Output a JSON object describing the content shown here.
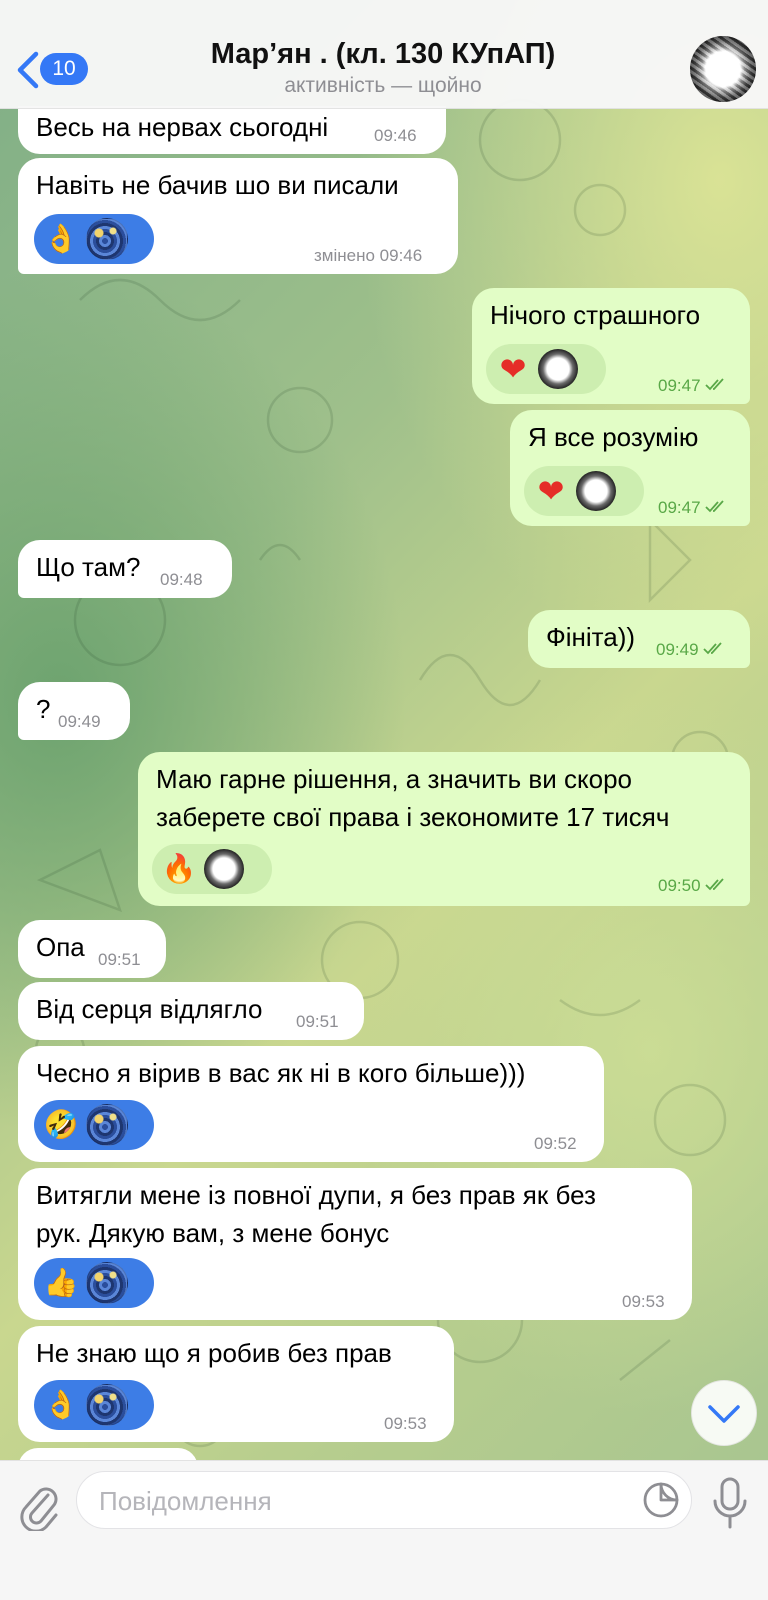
{
  "header": {
    "back_count": "10",
    "title": "Мар’ян . (кл. 130 КУпАП)",
    "status": "активність — щойно"
  },
  "messages": [
    {
      "side": "in",
      "text": "Весь на нервах сьогодні",
      "time": "09:46"
    },
    {
      "side": "in",
      "text": "Навіть не бачив шо ви писали",
      "time": "змінено 09:46",
      "reaction": "👌"
    },
    {
      "side": "out",
      "text": "Нічого страшного",
      "time": "09:47",
      "reaction": "❤"
    },
    {
      "side": "out",
      "text": "Я все розумію",
      "time": "09:47",
      "reaction": "❤"
    },
    {
      "side": "in",
      "text": "Що там?",
      "time": "09:48"
    },
    {
      "side": "out",
      "text": "Фініта))",
      "time": "09:49"
    },
    {
      "side": "in",
      "text": "?",
      "time": "09:49"
    },
    {
      "side": "out",
      "lines": [
        "Маю гарне рішення, а значить ви скоро",
        "заберете свої права і зекономите 17 тисяч"
      ],
      "time": "09:50",
      "reaction": "🔥"
    },
    {
      "side": "in",
      "text": "Опа",
      "time": "09:51"
    },
    {
      "side": "in",
      "text": "Від серця відлягло",
      "time": "09:51"
    },
    {
      "side": "in",
      "text": "Чесно я вірив в вас як ні в кого більше)))",
      "time": "09:52",
      "reaction": "🤣"
    },
    {
      "side": "in",
      "lines": [
        "Витягли мене із повної дупи, я без прав як без",
        "рук. Дякую вам, з мене бонус"
      ],
      "time": "09:53",
      "reaction": "👍"
    },
    {
      "side": "in",
      "text": "Не знаю що я робив без прав",
      "time": "09:53",
      "reaction": "👌"
    }
  ],
  "input": {
    "placeholder": "Повідомлення"
  },
  "icons": {
    "back": "chevron-left-icon",
    "attach": "paperclip-icon",
    "sticker": "sticker-icon",
    "mic": "microphone-icon",
    "scroll_down": "chevron-down-icon",
    "read_receipt": "double-check-icon"
  },
  "colors": {
    "accent": "#3478f6",
    "outgoing_bubble": "#e2fdc6",
    "incoming_bubble": "#ffffff",
    "read_check": "#59a847"
  }
}
